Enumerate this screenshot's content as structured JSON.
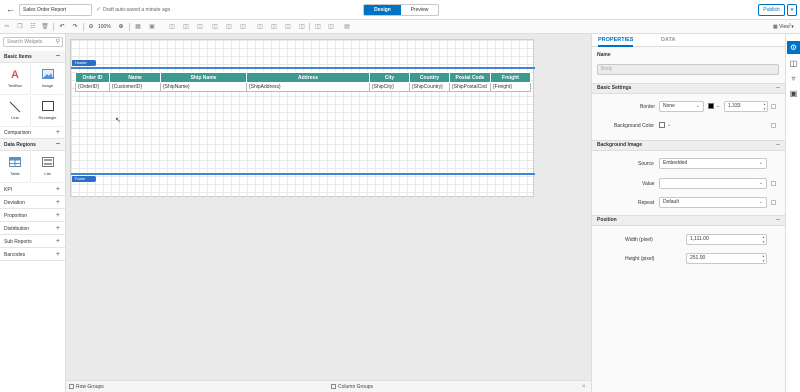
{
  "header": {
    "report_name": "Sales Order Report",
    "autosave_status": "Draft auto-saved a minute ago",
    "modes": [
      "Design",
      "Preview"
    ],
    "active_mode": "Design",
    "publish_label": "Publish",
    "publish_dropdown": "▾"
  },
  "toolbar": {
    "zoom": "100%",
    "view_label": "View"
  },
  "widgets": {
    "search_placeholder": "Search Widgets",
    "categories": {
      "basic_items": "Basic Items",
      "comparison": "Comparison",
      "data_regions": "Data Regions",
      "kpi": "KPI",
      "deviation": "Deviation",
      "proportion": "Proportion",
      "distribution": "Distribution",
      "sub_reports": "Sub Reports",
      "barcodes": "Barcodes"
    },
    "basic_items": [
      "TextBox",
      "Image",
      "Line",
      "Rectangle"
    ],
    "data_regions": [
      "Table",
      "List"
    ]
  },
  "design": {
    "header_band": "Header",
    "footer_band": "Footer",
    "table": {
      "columns": [
        "Order ID",
        "Name",
        "Ship Name",
        "Address",
        "City",
        "Country",
        "Postal Code",
        "Freight"
      ],
      "fields": [
        "{OrderID}",
        "{CustomerID}",
        "{ShipName}",
        "{ShipAddress}",
        "{ShipCity}",
        "{ShipCountry}",
        "{ShipPostalCod",
        "{Freight}"
      ]
    },
    "header_color": "#3d9a92",
    "band_color": "#2b6fc6"
  },
  "groups": {
    "row_groups": "Row Groups",
    "column_groups": "Column Groups",
    "close": "×"
  },
  "properties": {
    "tabs": [
      "PROPERTIES",
      "DATA"
    ],
    "active_tab": "PROPERTIES",
    "name_label": "Name",
    "name_value": "Body",
    "basic_settings": {
      "title": "Basic Settings",
      "border_label": "Border",
      "border_style": "None",
      "border_color": "#000000",
      "border_width": "1.333",
      "background_color_label": "Background Color"
    },
    "background_image": {
      "title": "Background Image",
      "source_label": "Source",
      "source_value": "Embedded",
      "value_label": "Value",
      "value_value": "",
      "repeat_label": "Repeat",
      "repeat_value": "Default"
    },
    "position": {
      "title": "Position",
      "width_label": "Width (pixel)",
      "width_value": "1,111.00",
      "height_label": "Height (pixel)",
      "height_value": "251.00"
    }
  },
  "accent_color": "#0072c6"
}
